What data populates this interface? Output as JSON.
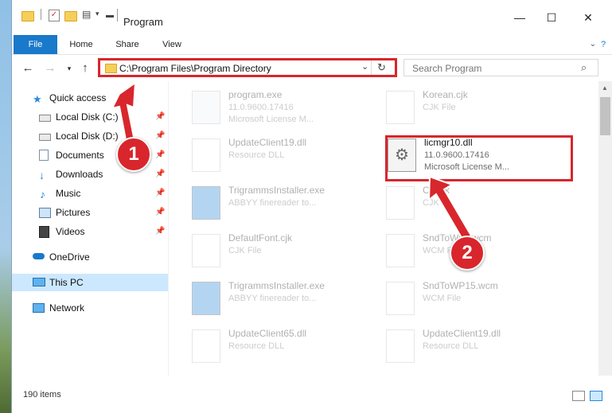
{
  "window": {
    "title": "Program",
    "controls": {
      "minimize": "—",
      "maximize": "☐",
      "close": "✕"
    }
  },
  "ribbon": {
    "tabs": [
      "File",
      "Home",
      "Share",
      "View"
    ]
  },
  "address": {
    "path": "C:\\Program Files\\Program Directory",
    "search_placeholder": "Search Program"
  },
  "sidebar": {
    "items": [
      {
        "label": "Quick access",
        "icon": "star-icon",
        "pinned": false
      },
      {
        "label": "Local Disk (C:)",
        "icon": "drive-icon",
        "pinned": true
      },
      {
        "label": "Local Disk (D:)",
        "icon": "drive-icon",
        "pinned": true
      },
      {
        "label": "Documents",
        "icon": "documents-icon",
        "pinned": true
      },
      {
        "label": "Downloads",
        "icon": "download-icon",
        "pinned": true
      },
      {
        "label": "Music",
        "icon": "music-icon",
        "pinned": true
      },
      {
        "label": "Pictures",
        "icon": "pictures-icon",
        "pinned": true
      },
      {
        "label": "Videos",
        "icon": "videos-icon",
        "pinned": true
      },
      {
        "label": "OneDrive",
        "icon": "cloud-icon",
        "pinned": false
      },
      {
        "label": "This PC",
        "icon": "computer-icon",
        "pinned": false,
        "selected": true
      },
      {
        "label": "Network",
        "icon": "network-icon",
        "pinned": false
      }
    ]
  },
  "files": [
    {
      "name": "program.exe",
      "line2": "11.0.9600.17416",
      "line3": "Microsoft License M...",
      "faded": true
    },
    {
      "name": "Korean.cjk",
      "line2": "CJK File",
      "line3": "",
      "faded": true
    },
    {
      "name": "UpdateClient19.dll",
      "line2": "Resource DLL",
      "line3": "",
      "faded": true
    },
    {
      "name": "licmgr10.dll",
      "line2": "11.0.9600.17416",
      "line3": "Microsoft License M...",
      "faded": false
    },
    {
      "name": "TrigrammsInstaller.exe",
      "line2": "ABBYY finereader to...",
      "line3": "",
      "faded": true
    },
    {
      "name": "Cd...jk",
      "line2": "CJK",
      "line3": "",
      "faded": true
    },
    {
      "name": "DefaultFont.cjk",
      "line2": "CJK File",
      "line3": "",
      "faded": true
    },
    {
      "name": "SndToWP...wcm",
      "line2": "WCM File",
      "line3": "",
      "faded": true
    },
    {
      "name": "TrigrammsInstaller.exe",
      "line2": "ABBYY finereader to...",
      "line3": "",
      "faded": true
    },
    {
      "name": "SndToWP15.wcm",
      "line2": "WCM File",
      "line3": "",
      "faded": true
    },
    {
      "name": "UpdateClient65.dll",
      "line2": "Resource DLL",
      "line3": "",
      "faded": true
    },
    {
      "name": "UpdateClient19.dll",
      "line2": "Resource DLL",
      "line3": "",
      "faded": true
    }
  ],
  "status": {
    "item_count": "190 items"
  },
  "annotations": {
    "step1": "1",
    "step2": "2"
  },
  "colors": {
    "accent": "#1979ca",
    "highlight": "#d8262c",
    "selected_nav": "#cce8ff"
  }
}
